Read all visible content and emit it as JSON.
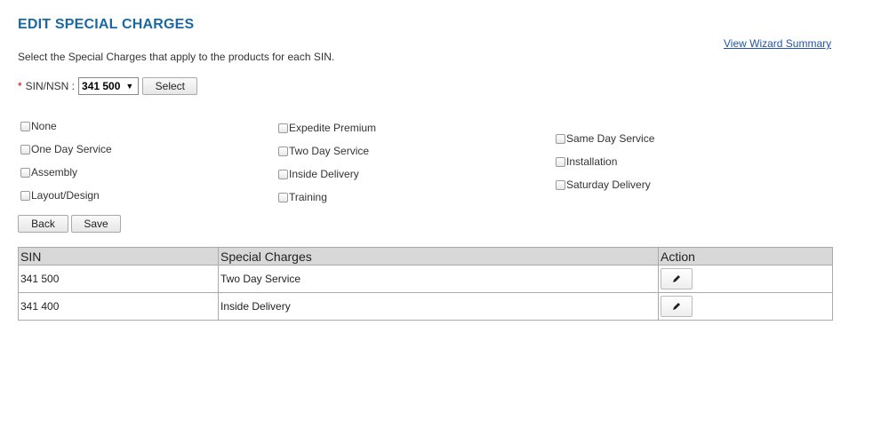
{
  "header": {
    "title": "EDIT SPECIAL CHARGES",
    "wizard_link": "View Wizard Summary"
  },
  "instructions": "Select the Special Charges that apply to the products for each SIN.",
  "sin_selector": {
    "required_marker": "*",
    "label": "SIN/NSN :",
    "selected_value": "341 500",
    "select_button": "Select"
  },
  "options": {
    "col1": [
      "None",
      "One Day Service",
      "Assembly",
      "Layout/Design"
    ],
    "col2": [
      "Expedite Premium",
      "Two Day Service",
      "Inside Delivery",
      "Training"
    ],
    "col3": [
      "Same Day Service",
      "Installation",
      "Saturday Delivery"
    ]
  },
  "buttons": {
    "back": "Back",
    "save": "Save"
  },
  "table": {
    "headers": [
      "SIN",
      "Special Charges",
      "Action"
    ],
    "rows": [
      {
        "sin": "341 500",
        "charge": "Two Day Service",
        "action_icon": "pencil-icon"
      },
      {
        "sin": "341 400",
        "charge": "Inside Delivery",
        "action_icon": "pencil-icon"
      }
    ]
  },
  "colors": {
    "title": "#1b69a3",
    "link": "#2255aa",
    "required": "#cc0000",
    "table_header_bg": "#d8d8d8"
  }
}
